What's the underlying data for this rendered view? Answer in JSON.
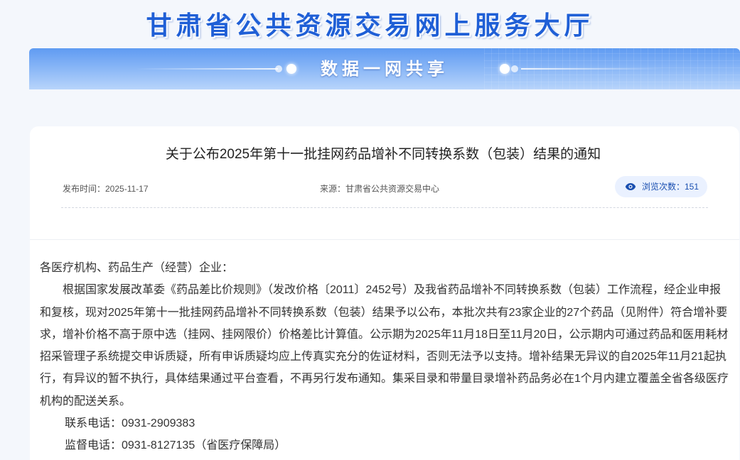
{
  "header": {
    "site_title": "甘肃省公共资源交易网上服务大厅",
    "banner_title": "数据一网共享"
  },
  "article": {
    "title": "关于公布2025年第十一批挂网药品增补不同转换系数（包装）结果的通知",
    "publish_time": "发布时间：2025-11-17",
    "source": "来源：甘肃省公共资源交易中心",
    "views": "浏览次数：151",
    "salutation": "各医疗机构、药品生产（经营）企业：",
    "paragraph": "根据国家发展改革委《药品差比价规则》（发改价格〔2011〕2452号）及我省药品增补不同转换系数（包装）工作流程，经企业申报和复核，现对2025年第十一批挂网药品增补不同转换系数（包装）结果予以公布，本批次共有23家企业的27个药品（见附件）符合增补要求，增补价格不高于原中选（挂网、挂网限价）价格差比计算值。公示期为2025年11月18日至11月20日，公示期内可通过药品和医用耗材招采管理子系统提交申诉质疑，所有申诉质疑均应上传真实充分的佐证材料，否则无法予以支持。增补结果无异议的自2025年11月21起执行，有异议的暂不执行，具体结果通过平台查看，不再另行发布通知。集采目录和带量目录增补药品务必在1个月内建立覆盖全省各级医疗机构的配送关系。",
    "contact_phone": "联系电话：0931-2909383",
    "supervise_phone": "监督电话：0931-8127135（省医疗保障局）"
  },
  "icons": {
    "views": "eye-icon"
  },
  "colors": {
    "brand_blue": "#1f5fd6",
    "banner_blue": "#5f9bf2",
    "page_bg": "#f4f7fc"
  }
}
